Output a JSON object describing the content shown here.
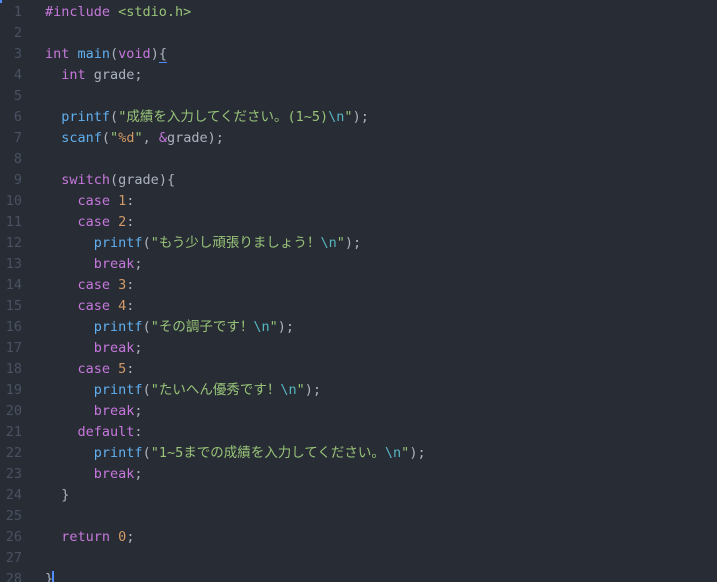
{
  "editor": {
    "language": "c",
    "colors": {
      "background": "#282c34",
      "line_number": "#495162",
      "keyword": "#c678dd",
      "function": "#61afef",
      "string": "#98c379",
      "escape": "#56b6c2",
      "number": "#d19a66",
      "text": "#abb2bf",
      "cursor": "#528bff"
    },
    "lines": [
      {
        "n": "1",
        "indent": 0,
        "tokens": [
          [
            "k",
            "#include "
          ],
          [
            "s",
            "<stdio.h>"
          ]
        ]
      },
      {
        "n": "2",
        "indent": 0,
        "tokens": []
      },
      {
        "n": "3",
        "indent": 0,
        "tokens": [
          [
            "k",
            "int "
          ],
          [
            "f",
            "main"
          ],
          [
            "p",
            "("
          ],
          [
            "k",
            "void"
          ],
          [
            "p",
            ")"
          ],
          [
            "p",
            "{"
          ]
        ]
      },
      {
        "n": "4",
        "indent": 1,
        "tokens": [
          [
            "k",
            "int "
          ],
          [
            "p",
            "grade;"
          ]
        ]
      },
      {
        "n": "5",
        "indent": 0,
        "tokens": []
      },
      {
        "n": "6",
        "indent": 1,
        "tokens": [
          [
            "f",
            "printf"
          ],
          [
            "p",
            "("
          ],
          [
            "s",
            "\"成績を入力してください。(1~5)"
          ],
          [
            "e",
            "\\n"
          ],
          [
            "s",
            "\""
          ],
          [
            "p",
            ");"
          ]
        ]
      },
      {
        "n": "7",
        "indent": 1,
        "tokens": [
          [
            "f",
            "scanf"
          ],
          [
            "p",
            "("
          ],
          [
            "s",
            "\""
          ],
          [
            "n",
            "%d"
          ],
          [
            "s",
            "\""
          ],
          [
            "p",
            ", "
          ],
          [
            "k",
            "&"
          ],
          [
            "p",
            "grade);"
          ]
        ]
      },
      {
        "n": "8",
        "indent": 0,
        "tokens": []
      },
      {
        "n": "9",
        "indent": 1,
        "tokens": [
          [
            "k",
            "switch"
          ],
          [
            "p",
            "(grade){"
          ]
        ]
      },
      {
        "n": "10",
        "indent": 2,
        "tokens": [
          [
            "k",
            "case "
          ],
          [
            "n",
            "1"
          ],
          [
            "p",
            ":"
          ]
        ]
      },
      {
        "n": "11",
        "indent": 2,
        "tokens": [
          [
            "k",
            "case "
          ],
          [
            "n",
            "2"
          ],
          [
            "p",
            ":"
          ]
        ]
      },
      {
        "n": "12",
        "indent": 3,
        "tokens": [
          [
            "f",
            "printf"
          ],
          [
            "p",
            "("
          ],
          [
            "s",
            "\"もう少し頑張りましょう！"
          ],
          [
            "e",
            "\\n"
          ],
          [
            "s",
            "\""
          ],
          [
            "p",
            ");"
          ]
        ]
      },
      {
        "n": "13",
        "indent": 3,
        "tokens": [
          [
            "k",
            "break"
          ],
          [
            "p",
            ";"
          ]
        ]
      },
      {
        "n": "14",
        "indent": 2,
        "tokens": [
          [
            "k",
            "case "
          ],
          [
            "n",
            "3"
          ],
          [
            "p",
            ":"
          ]
        ]
      },
      {
        "n": "15",
        "indent": 2,
        "tokens": [
          [
            "k",
            "case "
          ],
          [
            "n",
            "4"
          ],
          [
            "p",
            ":"
          ]
        ]
      },
      {
        "n": "16",
        "indent": 3,
        "tokens": [
          [
            "f",
            "printf"
          ],
          [
            "p",
            "("
          ],
          [
            "s",
            "\"その調子です！"
          ],
          [
            "e",
            "\\n"
          ],
          [
            "s",
            "\""
          ],
          [
            "p",
            ");"
          ]
        ]
      },
      {
        "n": "17",
        "indent": 3,
        "tokens": [
          [
            "k",
            "break"
          ],
          [
            "p",
            ";"
          ]
        ]
      },
      {
        "n": "18",
        "indent": 2,
        "tokens": [
          [
            "k",
            "case "
          ],
          [
            "n",
            "5"
          ],
          [
            "p",
            ":"
          ]
        ]
      },
      {
        "n": "19",
        "indent": 3,
        "tokens": [
          [
            "f",
            "printf"
          ],
          [
            "p",
            "("
          ],
          [
            "s",
            "\"たいへん優秀です！"
          ],
          [
            "e",
            "\\n"
          ],
          [
            "s",
            "\""
          ],
          [
            "p",
            ");"
          ]
        ]
      },
      {
        "n": "20",
        "indent": 3,
        "tokens": [
          [
            "k",
            "break"
          ],
          [
            "p",
            ";"
          ]
        ]
      },
      {
        "n": "21",
        "indent": 2,
        "tokens": [
          [
            "k",
            "default"
          ],
          [
            "p",
            ":"
          ]
        ]
      },
      {
        "n": "22",
        "indent": 3,
        "tokens": [
          [
            "f",
            "printf"
          ],
          [
            "p",
            "("
          ],
          [
            "s",
            "\"1~5までの成績を入力してください。"
          ],
          [
            "e",
            "\\n"
          ],
          [
            "s",
            "\""
          ],
          [
            "p",
            ");"
          ]
        ]
      },
      {
        "n": "23",
        "indent": 3,
        "tokens": [
          [
            "k",
            "break"
          ],
          [
            "p",
            ";"
          ]
        ]
      },
      {
        "n": "24",
        "indent": 1,
        "tokens": [
          [
            "p",
            "}"
          ]
        ]
      },
      {
        "n": "25",
        "indent": 0,
        "tokens": []
      },
      {
        "n": "26",
        "indent": 1,
        "tokens": [
          [
            "k",
            "return "
          ],
          [
            "n",
            "0"
          ],
          [
            "p",
            ";"
          ]
        ]
      },
      {
        "n": "27",
        "indent": 0,
        "tokens": []
      },
      {
        "n": "28",
        "indent": 0,
        "tokens": [
          [
            "p",
            "}"
          ]
        ]
      }
    ]
  }
}
